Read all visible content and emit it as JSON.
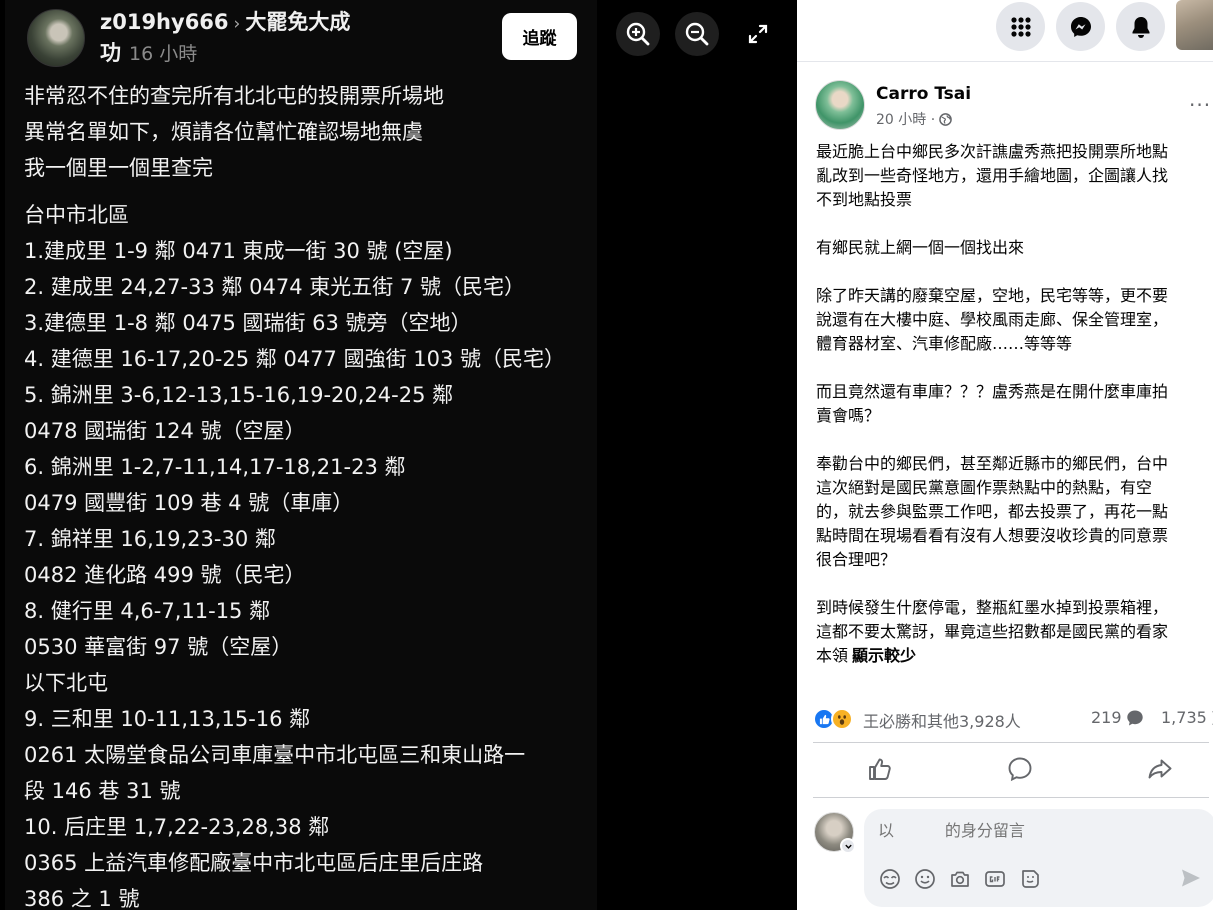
{
  "viewer": {
    "author": "z019hy666",
    "separator": "›",
    "group_line1": "大罷免大成",
    "group_line2": "功",
    "time": "16 小時",
    "follow_label": "追蹤",
    "lines": [
      "非常忍不住的查完所有北北屯的投開票所場地",
      "異常名單如下，煩請各位幫忙確認場地無虞",
      "我一個里一個里查完",
      "",
      "台中市北區",
      "1.建成里 1-9 鄰 0471 東成一街 30 號 (空屋)",
      "2. 建成里 24,27-33 鄰 0474 東光五街 7 號（民宅）",
      "3.建德里 1-8 鄰 0475 國瑞街 63 號旁（空地）",
      "4. 建德里 16-17,20-25 鄰 0477 國強街 103 號（民宅）",
      "5. 錦洲里 3-6,12-13,15-16,19-20,24-25 鄰",
      "0478 國瑞街 124 號（空屋）",
      "6. 錦洲里 1-2,7-11,14,17-18,21-23 鄰",
      "0479 國豐街 109 巷 4 號（車庫）",
      "7. 錦祥里 16,19,23-30 鄰",
      "0482 進化路 499 號（民宅）",
      "8. 健行里 4,6-7,11-15 鄰",
      "0530 華富街 97 號（空屋）",
      "以下北屯",
      "9. 三和里 10-11,13,15-16 鄰",
      "0261 太陽堂食品公司車庫臺中市北屯區三和東山路一",
      "段 146 巷 31 號",
      "10. 后庄里 1,7,22-23,28,38 鄰",
      "0365 上益汽車修配廠臺中市北屯區后庄里后庄路",
      "386 之 1 號"
    ]
  },
  "facebook": {
    "author": "Carro Tsai",
    "time": "20 小時 ·",
    "more_label": "···",
    "post_lines": [
      "最近脆上台中鄉民多次訐譙盧秀燕把投開票所地點",
      "亂改到一些奇怪地方，還用手繪地圖，企圖讓人找",
      "不到地點投票",
      "",
      "有鄉民就上網一個一個找出來",
      "",
      "除了昨天講的廢棄空屋，空地，民宅等等，更不要",
      "說還有在大樓中庭、學校風雨走廊、保全管理室，",
      "體育器材室、汽車修配廠……等等等",
      "",
      "而且竟然還有車庫？？？盧秀燕是在開什麼車庫拍",
      "賣會嗎？",
      "",
      "奉勸台中的鄉民們，甚至鄰近縣市的鄉民們，台中",
      "這次絕對是國民黨意圖作票熱點中的熱點，有空",
      "的，就去參與監票工作吧，都去投票了，再花一點",
      "點時間在現場看看有沒有人想要沒收珍貴的同意票",
      "很合理吧？",
      "",
      "到時候發生什麼停電，整瓶紅墨水掉到投票箱裡，",
      "這都不要太驚訝，畢竟這些招數都是國民黨的看家",
      "本領"
    ],
    "see_more": "顯示較少",
    "reactions_text": "王必勝和其他3,928人",
    "comments_count": "219",
    "shares_count": "1,735",
    "comment_placeholder": "以          的身分留言"
  },
  "colors": {
    "fb_blue": "#1877f2",
    "wow_yellow": "#f7b125",
    "viewer_bg": "#000000",
    "fb_gray": "#e4e6eb"
  },
  "icons": {
    "zoom_in": "zoom-in-icon",
    "zoom_out": "zoom-out-icon",
    "fullscreen": "fullscreen-icon",
    "menu": "grid-menu-icon",
    "messenger": "messenger-icon",
    "notifications": "bell-icon"
  }
}
